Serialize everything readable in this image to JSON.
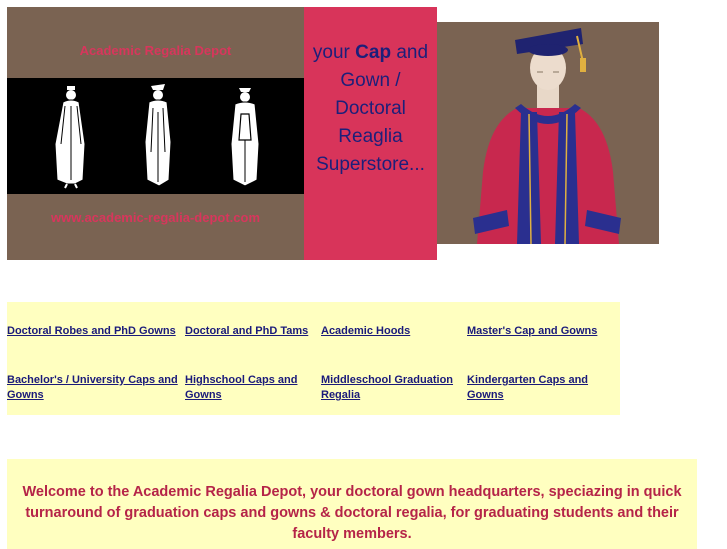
{
  "banner": {
    "brand_title": "Academic Regalia Depot",
    "brand_url": "www.academic-regalia-depot.com",
    "tagline_part1": "your ",
    "tagline_bold": "Cap",
    "tagline_part2": " and Gown / Doctoral Reaglia Superstore..."
  },
  "nav": {
    "links": [
      "Doctoral Robes and PhD Gowns",
      "Doctoral and PhD Tams",
      "Academic Hoods",
      "Master's Cap and Gowns",
      "Bachelor's / University Caps and Gowns",
      "Highschool Caps and Gowns",
      "Middleschool Graduation Regalia",
      "Kindergarten Caps and Gowns"
    ]
  },
  "welcome": {
    "text": "Welcome to the Academic Regalia Depot, your doctoral gown headquarters, speciazing in quick turnaround of graduation caps and gowns & doctoral regalia, for graduating students and their faculty members."
  },
  "colors": {
    "banner_brown": "#7a6352",
    "banner_pink": "#d8345a",
    "tagline_navy": "#1c1f7a",
    "panel_yellow": "#ffffc0",
    "link_navy": "#1a1a7a",
    "welcome_red": "#b52448"
  }
}
